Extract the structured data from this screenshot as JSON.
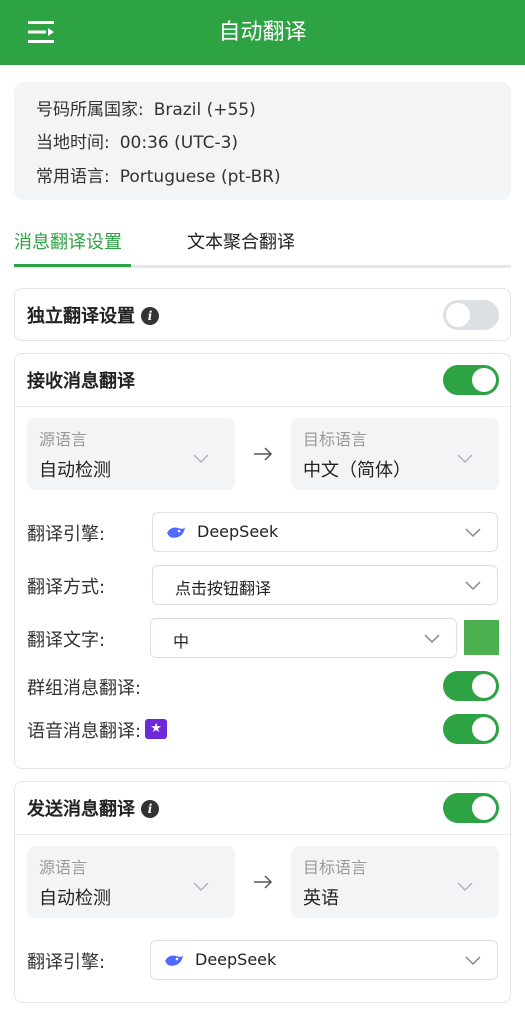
{
  "header": {
    "title": "自动翻译",
    "menu_icon": "menu-fold-icon"
  },
  "info": {
    "country_label": "号码所属国家:",
    "country_value": "Brazil (+55)",
    "time_label": "当地时间:",
    "time_value": "00:36 (UTC-3)",
    "language_label": "常用语言:",
    "language_value": "Portuguese (pt-BR)"
  },
  "tabs": [
    {
      "label": "消息翻译设置",
      "active": true
    },
    {
      "label": "文本聚合翻译",
      "active": false
    }
  ],
  "independent": {
    "title": "独立翻译设置",
    "enabled": false
  },
  "receive": {
    "title": "接收消息翻译",
    "enabled": true,
    "source_label": "源语言",
    "source_value": "自动检测",
    "target_label": "目标语言",
    "target_value": "中文（简体）",
    "engine_label": "翻译引擎:",
    "engine_value": "DeepSeek",
    "mode_label": "翻译方式:",
    "mode_value": "点击按钮翻译",
    "text_label": "翻译文字:",
    "text_value": "中",
    "text_color": "#4caf50",
    "group_label": "群组消息翻译:",
    "group_enabled": true,
    "voice_label": "语音消息翻译:",
    "voice_enabled": true
  },
  "send": {
    "title": "发送消息翻译",
    "enabled": true,
    "source_label": "源语言",
    "source_value": "自动检测",
    "target_label": "目标语言",
    "target_value": "英语",
    "engine_label": "翻译引擎:",
    "engine_value": "DeepSeek"
  },
  "colors": {
    "brand": "#2ea343",
    "toggle_off": "#dcdfe4",
    "premium": "#6d28d9"
  }
}
